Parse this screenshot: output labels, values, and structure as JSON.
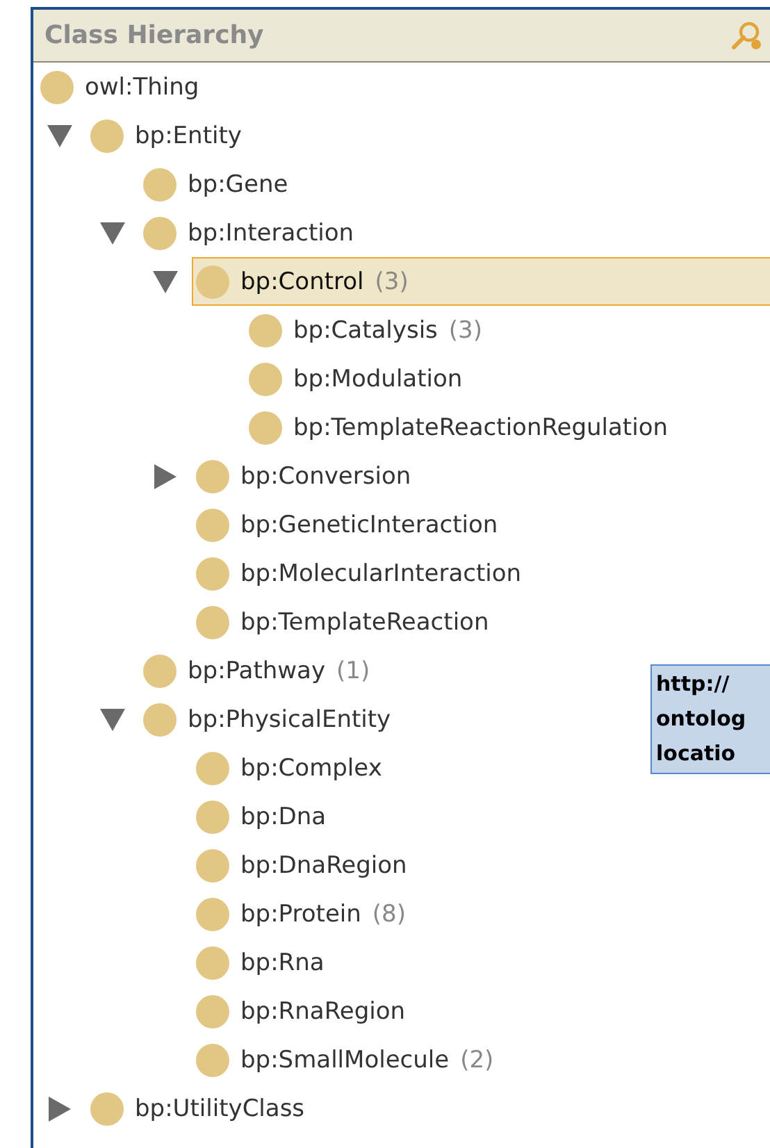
{
  "panel": {
    "title": "Class Hierarchy"
  },
  "tree": [
    {
      "label": "owl:Thing",
      "selected": false,
      "children": [
        {
          "label": "bp:Entity",
          "expanded": true,
          "selected": false,
          "children": [
            {
              "label": "bp:Gene",
              "selected": false
            },
            {
              "label": "bp:Interaction",
              "expanded": true,
              "selected": false,
              "children": [
                {
                  "label": "bp:Control",
                  "count": "(3)",
                  "expanded": true,
                  "selected": true,
                  "children": [
                    {
                      "label": "bp:Catalysis",
                      "count": "(3)",
                      "selected": false
                    },
                    {
                      "label": "bp:Modulation",
                      "selected": false
                    },
                    {
                      "label": "bp:TemplateReactionRegulation",
                      "selected": false
                    }
                  ]
                },
                {
                  "label": "bp:Conversion",
                  "expanded": false,
                  "selected": false
                },
                {
                  "label": "bp:GeneticInteraction",
                  "selected": false
                },
                {
                  "label": "bp:MolecularInteraction",
                  "selected": false
                },
                {
                  "label": "bp:TemplateReaction",
                  "selected": false
                }
              ]
            },
            {
              "label": "bp:Pathway",
              "count": "(1)",
              "selected": false
            },
            {
              "label": "bp:PhysicalEntity",
              "expanded": true,
              "selected": false,
              "children": [
                {
                  "label": "bp:Complex",
                  "selected": false
                },
                {
                  "label": "bp:Dna",
                  "selected": false
                },
                {
                  "label": "bp:DnaRegion",
                  "selected": false
                },
                {
                  "label": "bp:Protein",
                  "count": "(8)",
                  "selected": false
                },
                {
                  "label": "bp:Rna",
                  "selected": false
                },
                {
                  "label": "bp:RnaRegion",
                  "selected": false
                },
                {
                  "label": "bp:SmallMolecule",
                  "count": "(2)",
                  "selected": false
                }
              ]
            }
          ]
        },
        {
          "label": "bp:UtilityClass",
          "expanded": false,
          "selected": false
        }
      ]
    }
  ],
  "tooltip": {
    "lines": [
      "http://",
      "ontolog",
      "locatio"
    ]
  }
}
